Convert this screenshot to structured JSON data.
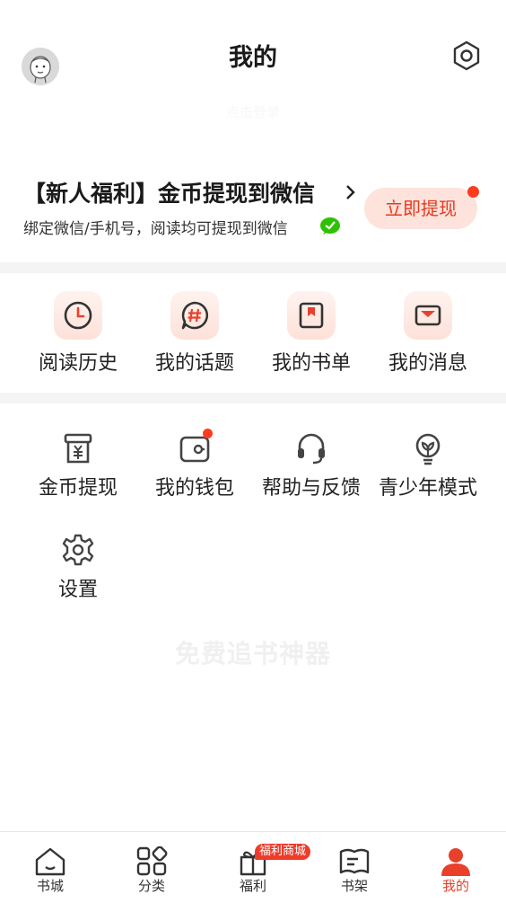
{
  "header": {
    "title": "我的",
    "login_hint": "点击登录"
  },
  "promo": {
    "title": "【新人福利】金币提现到微信",
    "subtitle": "绑定微信/手机号，阅读均可提现到微信",
    "button_label": "立即提现"
  },
  "quick_items": [
    {
      "label": "阅读历史",
      "icon": "clock-icon"
    },
    {
      "label": "我的话题",
      "icon": "hashtag-icon"
    },
    {
      "label": "我的书单",
      "icon": "bookmark-icon"
    },
    {
      "label": "我的消息",
      "icon": "envelope-icon"
    }
  ],
  "tool_items": [
    {
      "label": "金币提现",
      "icon": "yuan-receipt-icon"
    },
    {
      "label": "我的钱包",
      "icon": "wallet-icon"
    },
    {
      "label": "帮助与反馈",
      "icon": "headset-icon"
    },
    {
      "label": "青少年模式",
      "icon": "sprout-icon"
    },
    {
      "label": "设置",
      "icon": "gear-icon"
    }
  ],
  "watermark": "免费追书神器",
  "bottom_nav": [
    {
      "label": "书城",
      "icon": "home-icon"
    },
    {
      "label": "分类",
      "icon": "grid-icon"
    },
    {
      "label": "福利",
      "icon": "gift-icon",
      "badge": "福利商城"
    },
    {
      "label": "书架",
      "icon": "book-icon"
    },
    {
      "label": "我的",
      "icon": "person-icon",
      "active": true
    }
  ],
  "colors": {
    "accent": "#e8402b",
    "accent_light": "#fde3dc",
    "divider": "#f4f4f4"
  }
}
